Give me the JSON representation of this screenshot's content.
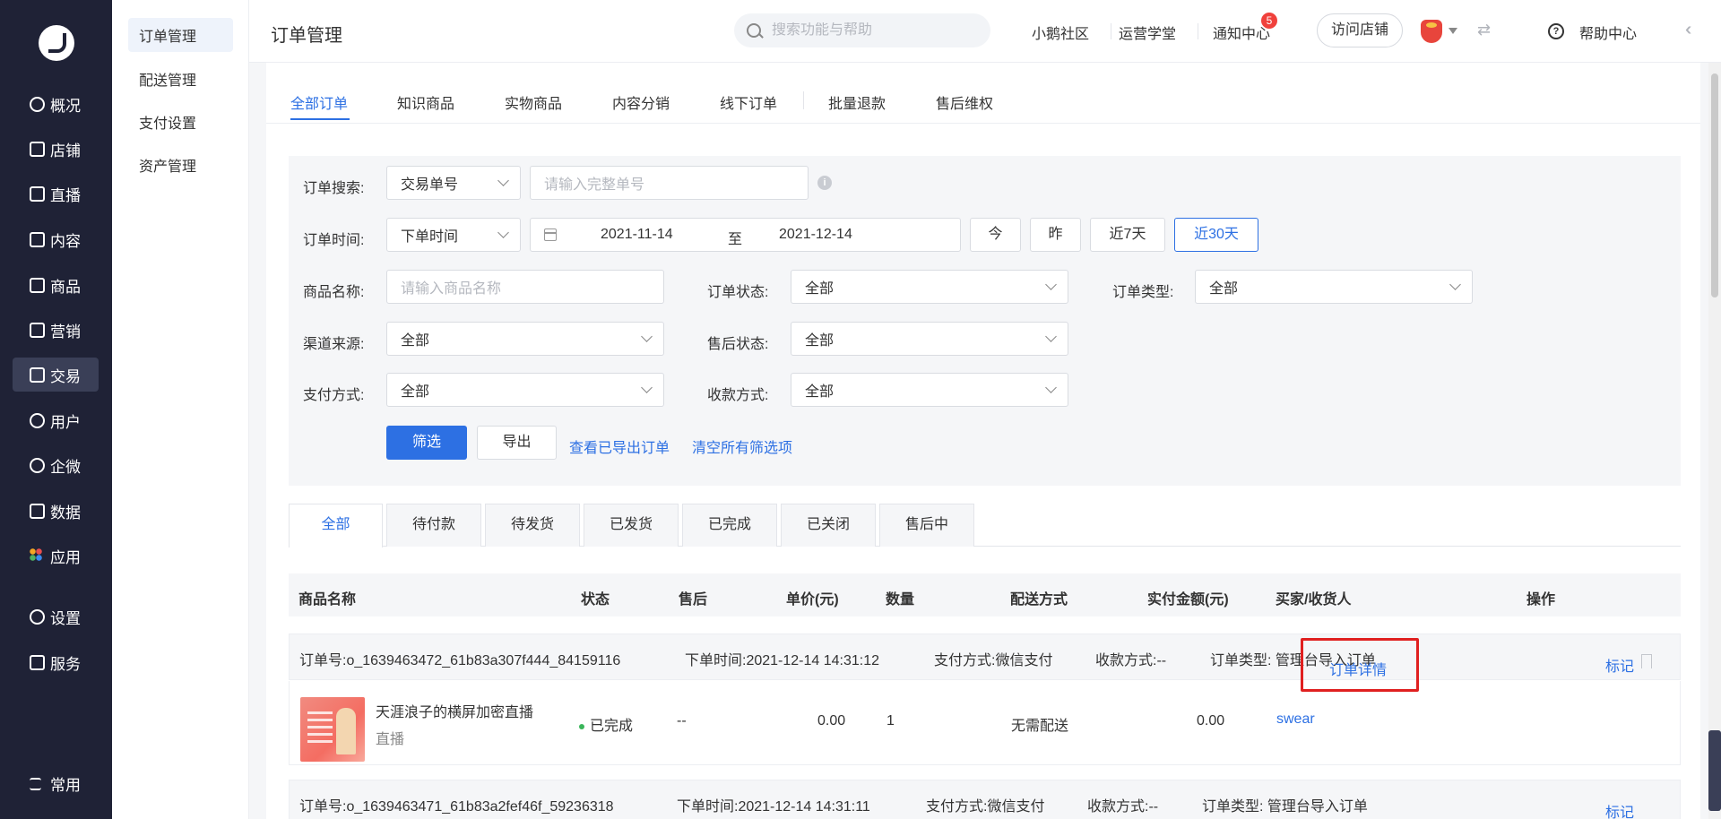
{
  "sidebar": {
    "items": [
      {
        "label": "概况",
        "icon": "dashboard-icon"
      },
      {
        "label": "店铺",
        "icon": "store-icon"
      },
      {
        "label": "直播",
        "icon": "live-icon"
      },
      {
        "label": "内容",
        "icon": "content-icon"
      },
      {
        "label": "商品",
        "icon": "product-icon"
      },
      {
        "label": "营销",
        "icon": "marketing-icon"
      },
      {
        "label": "交易",
        "icon": "trade-icon"
      },
      {
        "label": "用户",
        "icon": "user-icon"
      },
      {
        "label": "企微",
        "icon": "wecom-icon"
      },
      {
        "label": "数据",
        "icon": "data-icon"
      },
      {
        "label": "应用",
        "icon": "apps-icon"
      },
      {
        "label": "设置",
        "icon": "settings-icon"
      },
      {
        "label": "服务",
        "icon": "service-icon"
      },
      {
        "label": "常用",
        "icon": "common-icon"
      }
    ],
    "active": "交易"
  },
  "subnav": {
    "items": [
      "订单管理",
      "配送管理",
      "支付设置",
      "资产管理"
    ],
    "active": "订单管理"
  },
  "header": {
    "title": "订单管理",
    "search_placeholder": "搜索功能与帮助",
    "links": [
      "小鹅社区",
      "运营学堂",
      "通知中心"
    ],
    "notification_count": "5",
    "visit_store": "访问店铺",
    "help": "帮助中心"
  },
  "tabs": [
    "全部订单",
    "知识商品",
    "实物商品",
    "内容分销",
    "线下订单",
    "批量退款",
    "售后维权"
  ],
  "filter": {
    "search_label": "订单搜索:",
    "search_type": "交易单号",
    "search_placeholder": "请输入完整单号",
    "time_label": "订单时间:",
    "time_type": "下单时间",
    "date_start": "2021-11-14",
    "date_sep": "至",
    "date_end": "2021-12-14",
    "quick": [
      "今",
      "昨",
      "近7天",
      "近30天"
    ],
    "product_label": "商品名称:",
    "product_placeholder": "请输入商品名称",
    "order_status_label": "订单状态:",
    "order_status_value": "全部",
    "order_type_label": "订单类型:",
    "order_type_value": "全部",
    "channel_label": "渠道来源:",
    "channel_value": "全部",
    "aftersale_label": "售后状态:",
    "aftersale_value": "全部",
    "pay_label": "支付方式:",
    "pay_value": "全部",
    "collect_label": "收款方式:",
    "collect_value": "全部",
    "filter_btn": "筛选",
    "export_btn": "导出",
    "view_exported": "查看已导出订单",
    "clear_all": "清空所有筛选项"
  },
  "status_tabs": [
    "全部",
    "待付款",
    "待发货",
    "已发货",
    "已完成",
    "已关闭",
    "售后中"
  ],
  "table": {
    "headers": [
      "商品名称",
      "状态",
      "售后",
      "单价(元)",
      "数量",
      "配送方式",
      "实付金额(元)",
      "买家/收货人",
      "操作"
    ]
  },
  "orders": [
    {
      "order_no": "订单号:o_1639463472_61b83a307f444_84159116",
      "order_time": "下单时间:2021-12-14 14:31:12",
      "pay_method": "支付方式:微信支付",
      "collect_method": "收款方式:--",
      "order_type": "订单类型: 管理台导入订单",
      "mark": "标记",
      "product_name": "天涯浪子的横屏加密直播",
      "product_type": "直播",
      "status": "已完成",
      "aftersale": "--",
      "unit_price": "0.00",
      "quantity": "1",
      "delivery": "无需配送",
      "paid": "0.00",
      "buyer": "swear",
      "action": "订单详情"
    },
    {
      "order_no": "订单号:o_1639463471_61b83a2fef46f_59236318",
      "order_time": "下单时间:2021-12-14 14:31:11",
      "pay_method": "支付方式:微信支付",
      "collect_method": "收款方式:--",
      "order_type": "订单类型: 管理台导入订单",
      "mark": "标记"
    }
  ],
  "colors": {
    "sidebar_bg": "#1f2236",
    "accent": "#2d70e3",
    "highlight": "#e02020",
    "status_done": "#3ab55a"
  }
}
